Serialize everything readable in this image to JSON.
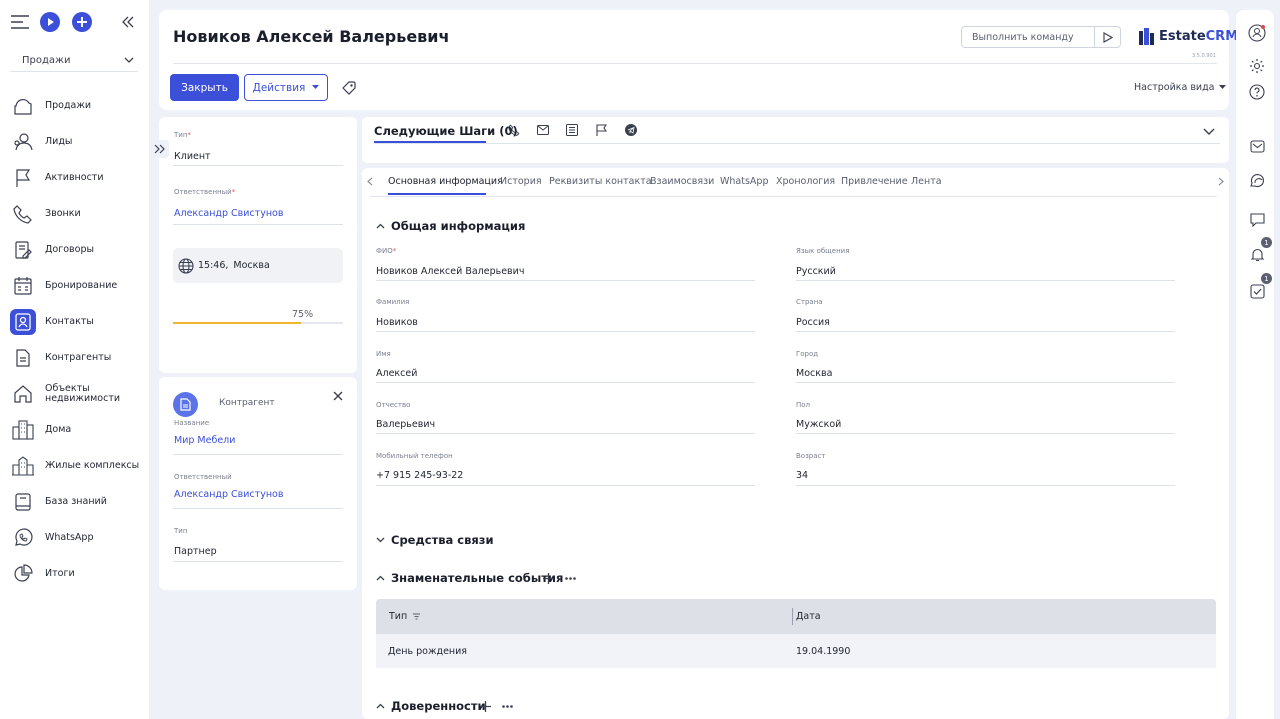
{
  "sidebar": {
    "section_select": "Продажи",
    "items": [
      {
        "label": "Продажи",
        "icon": "sales-icon"
      },
      {
        "label": "Лиды",
        "icon": "leads-icon"
      },
      {
        "label": "Активности",
        "icon": "flag-icon"
      },
      {
        "label": "Звонки",
        "icon": "phone-icon"
      },
      {
        "label": "Договоры",
        "icon": "contract-icon"
      },
      {
        "label": "Бронирование",
        "icon": "calendar-icon"
      },
      {
        "label": "Контакты",
        "icon": "contacts-icon"
      },
      {
        "label": "Контрагенты",
        "icon": "document-icon"
      },
      {
        "label": "Объекты недвижимости",
        "icon": "home-icon"
      },
      {
        "label": "Дома",
        "icon": "building-icon"
      },
      {
        "label": "Жилые комплексы",
        "icon": "complex-icon"
      },
      {
        "label": "База знаний",
        "icon": "book-icon"
      },
      {
        "label": "WhatsApp",
        "icon": "whatsapp-icon"
      },
      {
        "label": "Итоги",
        "icon": "pie-chart-icon"
      }
    ],
    "active": "Контакты"
  },
  "header": {
    "title": "Новиков Алексей Валерьевич",
    "command_placeholder": "Выполнить команду",
    "logo_text": "Estate",
    "logo_accent": "CRM",
    "version": "3.5.0.901",
    "close_label": "Закрыть",
    "actions_label": "Действия",
    "view_settings_label": "Настройка вида"
  },
  "info_card": {
    "type_label": "Тип",
    "type_value": "Клиент",
    "owner_label": "Ответственный",
    "owner_value": "Александр Свистунов",
    "time_value": "15:46,",
    "city_value": "Москва",
    "progress_label": "75%",
    "progress": 0.75
  },
  "counterparty": {
    "heading": "Контрагент",
    "name_label": "Название",
    "name_value": "Мир Мебели",
    "owner_label": "Ответственный",
    "owner_value": "Александр Свистунов",
    "type_label": "Тип",
    "type_value": "Партнер"
  },
  "next_steps": {
    "title": "Следующие Шаги (0)"
  },
  "tabs": [
    "Основная информация",
    "История",
    "Реквизиты контакта",
    "Взаимосвязи",
    "WhatsApp",
    "Хронология",
    "Привлечение",
    "Лента"
  ],
  "general": {
    "title": "Общая информация",
    "fields_left": [
      {
        "label": "ФИО",
        "value": "Новиков Алексей Валерьевич",
        "required": true
      },
      {
        "label": "Фамилия",
        "value": "Новиков"
      },
      {
        "label": "Имя",
        "value": "Алексей"
      },
      {
        "label": "Отчество",
        "value": "Валерьевич"
      },
      {
        "label": "Мобильный телефон",
        "value": "+7 915 245-93-22"
      }
    ],
    "fields_right": [
      {
        "label": "Язык общения",
        "value": "Русский"
      },
      {
        "label": "Страна",
        "value": "Россия"
      },
      {
        "label": "Город",
        "value": "Москва"
      },
      {
        "label": "Пол",
        "value": "Мужской"
      },
      {
        "label": "Возраст",
        "value": "34"
      }
    ]
  },
  "comms": {
    "title": "Средства связи"
  },
  "events": {
    "title": "Знаменательные события",
    "col_type": "Тип",
    "col_date": "Дата",
    "rows": [
      {
        "type": "День рождения",
        "date": "19.04.1990"
      }
    ]
  },
  "poa": {
    "title": "Доверенности"
  },
  "rail": {
    "badge_notifications": "1",
    "badge_tasks": "1"
  }
}
